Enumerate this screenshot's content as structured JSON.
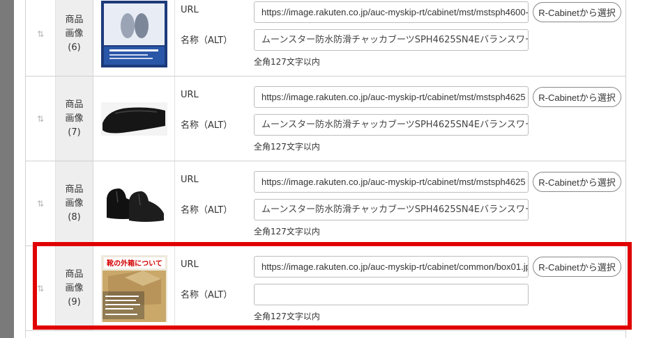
{
  "common": {
    "url_label": "URL",
    "alt_label": "名称（ALT）",
    "hint": "全角127文字以内",
    "select_button": "R-Cabinetから選択",
    "handle_glyph": "⇅"
  },
  "rows": [
    {
      "label_line1": "商品",
      "label_line2": "画像",
      "label_line3": "(6)",
      "image": "balance-works-flyer-image",
      "url": "https://image.rakuten.co.jp/auc-myskip-rt/cabinet/mst/mstsph4600-",
      "alt": "ムーンスター防水防滑チャッカブーツSPH4625SN4Eバランスワー"
    },
    {
      "label_line1": "商品",
      "label_line2": "画像",
      "label_line3": "(7)",
      "image": "black-boot-closeup-image",
      "url": "https://image.rakuten.co.jp/auc-myskip-rt/cabinet/mst/mstsph4625",
      "alt": "ムーンスター防水防滑チャッカブーツSPH4625SN4Eバランスワー"
    },
    {
      "label_line1": "商品",
      "label_line2": "画像",
      "label_line3": "(8)",
      "image": "black-chukka-boots-image",
      "url": "https://image.rakuten.co.jp/auc-myskip-rt/cabinet/mst/mstsph4625",
      "alt": "ムーンスター防水防滑チャッカブーツSPH4625SN4Eバランスワー"
    },
    {
      "label_line1": "商品",
      "label_line2": "画像",
      "label_line3": "(9)",
      "image": "shoe-box-notice-image",
      "image_caption": "靴の外箱について",
      "url": "https://image.rakuten.co.jp/auc-myskip-rt/cabinet/common/box01.jp",
      "alt": ""
    }
  ],
  "colors": {
    "highlight": "#e00000",
    "label_bg": "#eeeeee",
    "left_bar": "#7a7a7a"
  }
}
